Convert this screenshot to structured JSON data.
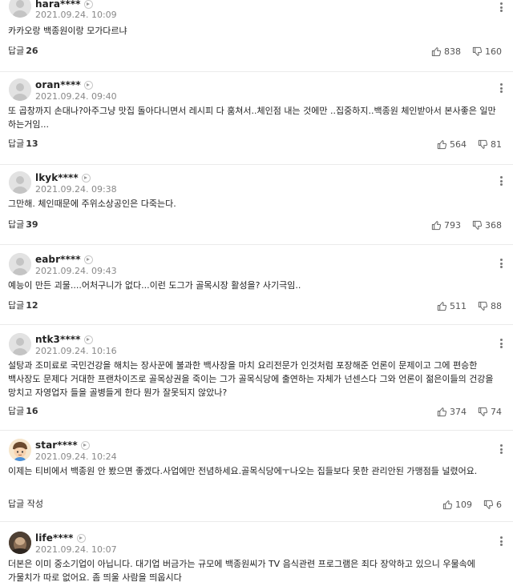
{
  "reply_label": "답글",
  "comments": [
    {
      "nickname": "hara****",
      "date": "2021.09.24. 10:09",
      "text": "카카오랑 백종원이랑 모가다르냐",
      "replies": "26",
      "likes": "838",
      "dislikes": "160"
    },
    {
      "nickname": "oran****",
      "date": "2021.09.24. 09:40",
      "text": "또 곱창까지 손대나?아주그냥 맛집 돌아다니면서 레시피 다 훔쳐서..체인점 내는 것에만 ..집중하지..백종원 체인받아서 본사좋은 일만 하는거임...",
      "replies": "13",
      "likes": "564",
      "dislikes": "81"
    },
    {
      "nickname": "lkyk****",
      "date": "2021.09.24. 09:38",
      "text": "그만해. 체인때문에 주위소상공인은 다죽는다.",
      "replies": "39",
      "likes": "793",
      "dislikes": "368"
    },
    {
      "nickname": "eabr****",
      "date": "2021.09.24. 09:43",
      "text": "예능이 만든 괴물....어처구니가 없다...이런 도그가 골목시장 활성을? 사기극임..",
      "replies": "12",
      "likes": "511",
      "dislikes": "88"
    },
    {
      "nickname": "ntk3****",
      "date": "2021.09.24. 10:16",
      "text": "설탕과 조미료로 국민건강을 해치는 장사꾼에 불과한 백사장을 마치 요리전문가 인것처럼 포장해준 언론이 문제이고 그에 편승한 백사장도 문제다 거대한 프랜차이즈로 골목상권을 죽이는 그가 골목식당에 출연하는 자체가 넌센스다 그와 언론이 젊은이들의 건강을 망치고 자영업자 들을 골병들게 한다 뭔가 잘못되지 않았나?",
      "replies": "16",
      "likes": "374",
      "dislikes": "74"
    },
    {
      "nickname": "star****",
      "date": "2021.09.24. 10:24",
      "text": "이제는 티비에서 백종원 안 봤으면 좋겠다.사업에만 전념하세요.골목식당에ㅜ나오는 집들보다 못한 관리안된 가맹점들 널렸어요.",
      "replies": "",
      "reply_write_label": "답글 작성",
      "likes": "109",
      "dislikes": "6"
    },
    {
      "nickname": "life****",
      "date": "2021.09.24. 10:07",
      "text": "더본은 이미 중소기업이 아닙니다. 대기업 버금가는 규모에 백종원씨가 TV 음식관련 프로그램은 죄다 장악하고 있으니 우물속에 가물치가 따로 없어요. 좀 띄울 사람을 띄웁시다"
    }
  ],
  "icons": {
    "like": "thumbs-up-icon",
    "dislike": "thumbs-down-icon",
    "more": "more-vertical-icon",
    "profile_arrow": "chevron-right-circle-icon"
  },
  "colors": {
    "text": "#222222",
    "meta": "#888888",
    "divider": "#ebebeb"
  }
}
